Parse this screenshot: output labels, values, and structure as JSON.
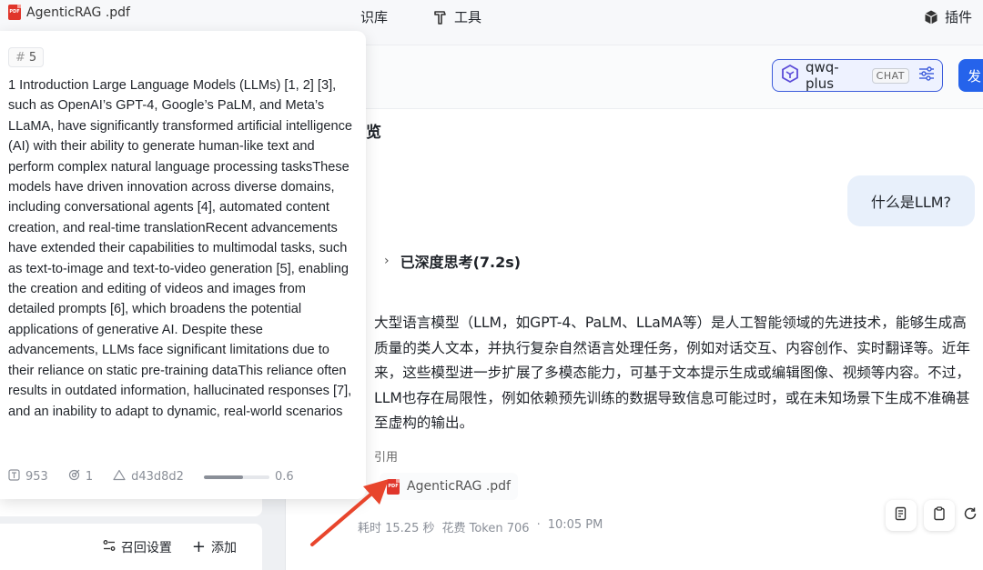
{
  "file": {
    "name": "AgenticRAG .pdf",
    "icon": "pdf-icon"
  },
  "nav": {
    "knowledge_base": "识库",
    "tools": "工具",
    "plugins": "插件"
  },
  "chunk": {
    "index": "5",
    "text": "1 Introduction Large Language Models (LLMs) [1, 2] [3], such as OpenAI’s GPT-4, Google’s PaLM, and Meta’s LLaMA, have significantly transformed artificial intelligence (AI) with their ability to generate human-like text and perform complex natural language processing tasksThese models have driven innovation across diverse domains, including conversational agents [4], automated content creation, and real-time translationRecent advancements have extended their capabilities to multimodal tasks, such as text-to-image and text-to-video generation [5], enabling the creation and editing of videos and images from detailed prompts [6], which broadens the potential applications of generative AI. Despite these advancements, LLMs face significant limitations due to their reliance on static pre-training dataThis reliance often results in outdated information, hallucinated responses [7], and an inability to adapt to dynamic, real-world scenarios",
    "tokens": "953",
    "hits": "1",
    "hash": "d43d8d2",
    "score": "0.6",
    "score_value": 0.6
  },
  "left_actions": {
    "recall_settings": "召回设置",
    "add": "添加"
  },
  "model": {
    "name": "qwq-plus",
    "tag": "CHAT"
  },
  "send_label": "发",
  "preview_title": "览",
  "user_message": "什么是LLM?",
  "thinking_label": "已深度思考(7.2s)",
  "answer": "大型语言模型（LLM，如GPT-4、PaLM、LLaMA等）是人工智能领域的先进技术，能够生成高质量的类人文本，并执行复杂自然语言处理任务，例如对话交互、内容创作、实时翻译等。近年来，这些模型进一步扩展了多模态能力，可基于文本提示生成或编辑图像、视频等内容。不过，LLM也存在局限性，例如依赖预先训练的数据导致信息可能过时，或在未知场景下生成不准确甚至虚构的输出。",
  "citation": {
    "label": "引用",
    "file": "AgenticRAG .pdf"
  },
  "footer": {
    "time": "耗时 15.25 秒",
    "tokens": "花费 Token 706",
    "dot": "·",
    "clock": "10:05 PM"
  },
  "colors": {
    "accent": "#2563eb",
    "pdf_red": "#e0352b",
    "arrow": "#e8452c"
  }
}
